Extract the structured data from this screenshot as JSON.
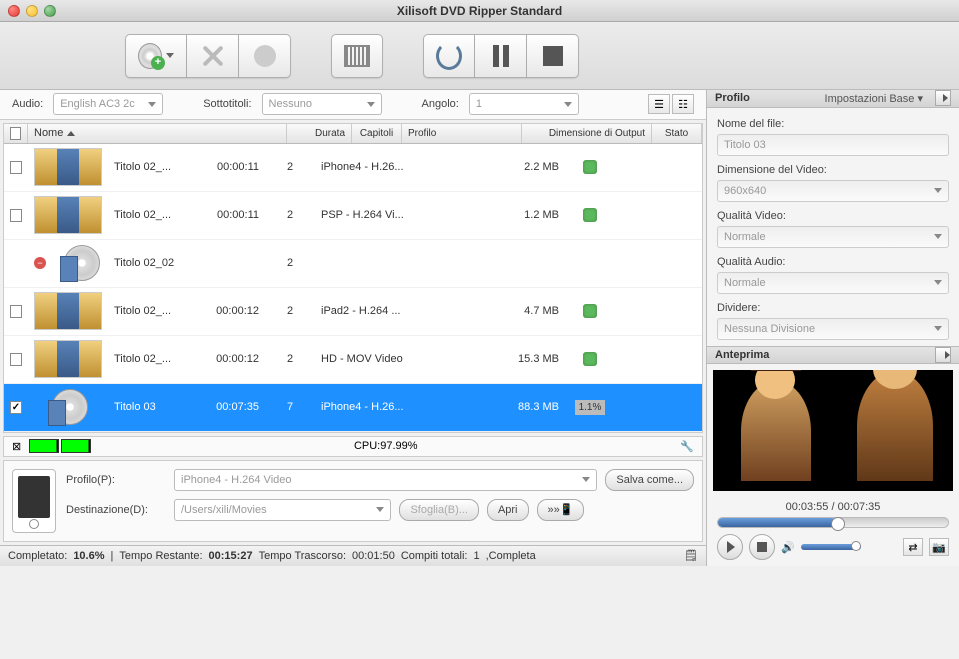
{
  "title": "Xilisoft DVD Ripper Standard",
  "filter": {
    "audio_label": "Audio:",
    "audio_value": "English AC3 2c",
    "subs_label": "Sottotitoli:",
    "subs_value": "Nessuno",
    "angle_label": "Angolo:",
    "angle_value": "1"
  },
  "columns": {
    "nome": "Nome",
    "durata": "Durata",
    "capitoli": "Capitoli",
    "profilo": "Profilo",
    "dim": "Dimensione di Output",
    "stato": "Stato"
  },
  "rows": [
    {
      "checked": false,
      "thumb": "strip",
      "name": "Titolo 02_...",
      "durata": "00:00:11",
      "cap": "2",
      "profilo": "iPhone4 - H.26...",
      "dim": "2.2 MB",
      "status": "ok"
    },
    {
      "checked": false,
      "thumb": "strip",
      "name": "Titolo 02_...",
      "durata": "00:00:11",
      "cap": "2",
      "profilo": "PSP - H.264 Vi...",
      "dim": "1.2 MB",
      "status": "ok"
    },
    {
      "checked": null,
      "thumb": "disc",
      "name": "Titolo 02_02",
      "durata": "",
      "cap": "2",
      "profilo": "",
      "dim": "",
      "status": "minus"
    },
    {
      "checked": false,
      "thumb": "strip",
      "name": "Titolo 02_...",
      "durata": "00:00:12",
      "cap": "2",
      "profilo": "iPad2 - H.264 ...",
      "dim": "4.7 MB",
      "status": "ok"
    },
    {
      "checked": false,
      "thumb": "strip",
      "name": "Titolo 02_...",
      "durata": "00:00:12",
      "cap": "2",
      "profilo": "HD - MOV Video",
      "dim": "15.3 MB",
      "status": "ok"
    },
    {
      "checked": true,
      "thumb": "disc",
      "name": "Titolo 03",
      "durata": "00:07:35",
      "cap": "7",
      "profilo": "iPhone4 - H.26...",
      "dim": "88.3 MB",
      "status": "progress",
      "progress": "1.1%",
      "selected": true
    }
  ],
  "cpu": {
    "label": "CPU:97.99%"
  },
  "bottom": {
    "profile_label": "Profilo(P):",
    "profile_value": "iPhone4 - H.264 Video",
    "save_label": "Salva come...",
    "dest_label": "Destinazione(D):",
    "dest_value": "/Users/xili/Movies",
    "browse_label": "Sfoglia(B)...",
    "open_label": "Apri"
  },
  "status": {
    "completed_label": "Completato:",
    "completed_value": "10.6%",
    "remaining_label": "Tempo Restante:",
    "remaining_value": "00:15:27",
    "elapsed_label": "Tempo Trascorso:",
    "elapsed_value": "00:01:50",
    "tasks_label": "Compiti totali:",
    "tasks_value": "1",
    "tail": ",Completa"
  },
  "panel": {
    "title": "Profilo",
    "settings_link": "Impostazioni Base",
    "file_label": "Nome del file:",
    "file_value": "Titolo 03",
    "dim_label": "Dimensione del Video:",
    "dim_value": "960x640",
    "vq_label": "Qualità Video:",
    "vq_value": "Normale",
    "aq_label": "Qualità Audio:",
    "aq_value": "Normale",
    "split_label": "Dividere:",
    "split_value": "Nessuna Divisione"
  },
  "preview": {
    "title": "Anteprima",
    "time": "00:03:55 / 00:07:35"
  }
}
